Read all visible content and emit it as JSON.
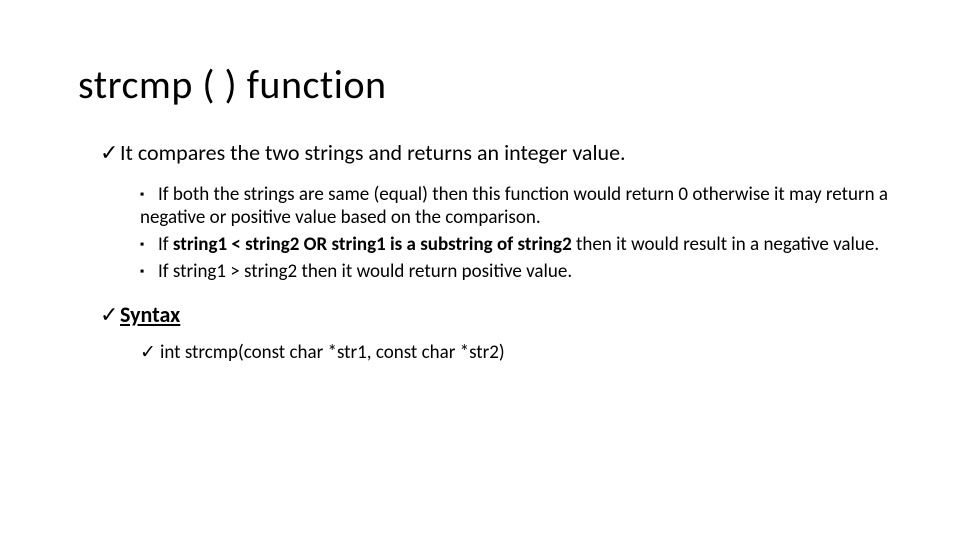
{
  "title": "strcmp ( ) function",
  "point1": "It compares the two strings and returns an integer value.",
  "sub1": "If both the strings are same (equal) then this function would return 0 otherwise it may return a negative or positive value based on the comparison.",
  "sub2_prefix": "If ",
  "sub2_bold": "string1 < string2 OR string1 is a substring of string2",
  "sub2_suffix": " then it would result in a negative value.",
  "sub3": "If string1 > string2 then it would return positive value.",
  "syntax_label": "Syntax",
  "syntax_code": "int strcmp(const char *str1, const char *str2)"
}
